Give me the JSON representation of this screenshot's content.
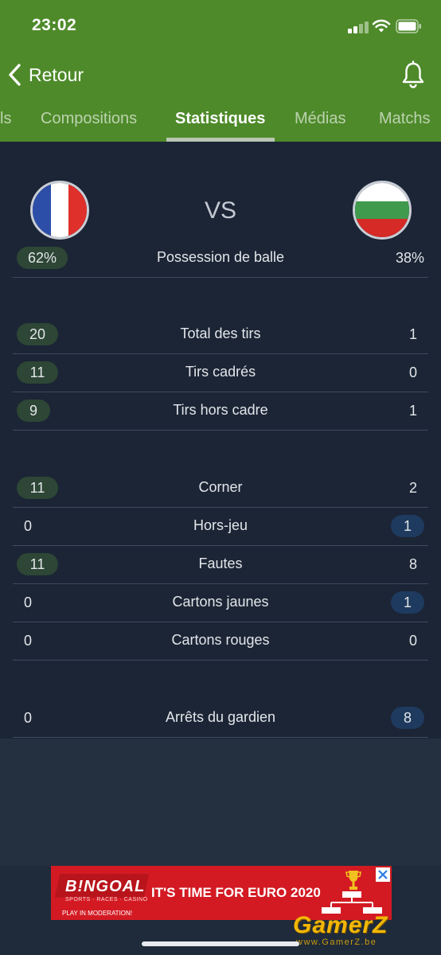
{
  "status_bar": {
    "time": "23:02"
  },
  "nav": {
    "back_label": "Retour"
  },
  "tabs": [
    {
      "label": "ls"
    },
    {
      "label": "Compositions"
    },
    {
      "label": "Statistiques",
      "active": true
    },
    {
      "label": "Médias"
    },
    {
      "label": "Matchs"
    }
  ],
  "match": {
    "vs_label": "VS",
    "home_flag": {
      "name": "france-flag",
      "colors": [
        "#2c4ea8",
        "#ffffff",
        "#e0302b"
      ]
    },
    "away_flag": {
      "name": "bulgaria-flag",
      "colors": [
        "#ffffff",
        "#3f9a4e",
        "#d62a26"
      ]
    }
  },
  "stats": [
    {
      "label": "Possession de balle",
      "home": "62%",
      "away": "38%",
      "highlight": "home"
    },
    {
      "label": "Total des tirs",
      "home": "20",
      "away": "1",
      "highlight": "home"
    },
    {
      "label": "Tirs cadrés",
      "home": "11",
      "away": "0",
      "highlight": "home"
    },
    {
      "label": "Tirs hors cadre",
      "home": "9",
      "away": "1",
      "highlight": "home"
    },
    {
      "label": "Corner",
      "home": "11",
      "away": "2",
      "highlight": "home"
    },
    {
      "label": "Hors-jeu",
      "home": "0",
      "away": "1",
      "highlight": "away"
    },
    {
      "label": "Fautes",
      "home": "11",
      "away": "8",
      "highlight": "home"
    },
    {
      "label": "Cartons jaunes",
      "home": "0",
      "away": "1",
      "highlight": "away"
    },
    {
      "label": "Cartons rouges",
      "home": "0",
      "away": "0",
      "highlight": "none"
    },
    {
      "label": "Arrêts du gardien",
      "home": "0",
      "away": "8",
      "highlight": "away"
    }
  ],
  "colors": {
    "header_green": "#4e8a2a",
    "content_bg": "#1b2535",
    "home_pill": "#2d4635",
    "away_pill": "#1e3a5e"
  },
  "ad": {
    "brand": "B!NGOAL",
    "brand_sub": "SPORTS · RACES · CASINO",
    "footer": "PLAY IN MODERATION!",
    "headline": "IT'S TIME FOR EURO 2020"
  },
  "watermark": {
    "name": "GamerZ",
    "url": "www.GamerZ.be"
  }
}
